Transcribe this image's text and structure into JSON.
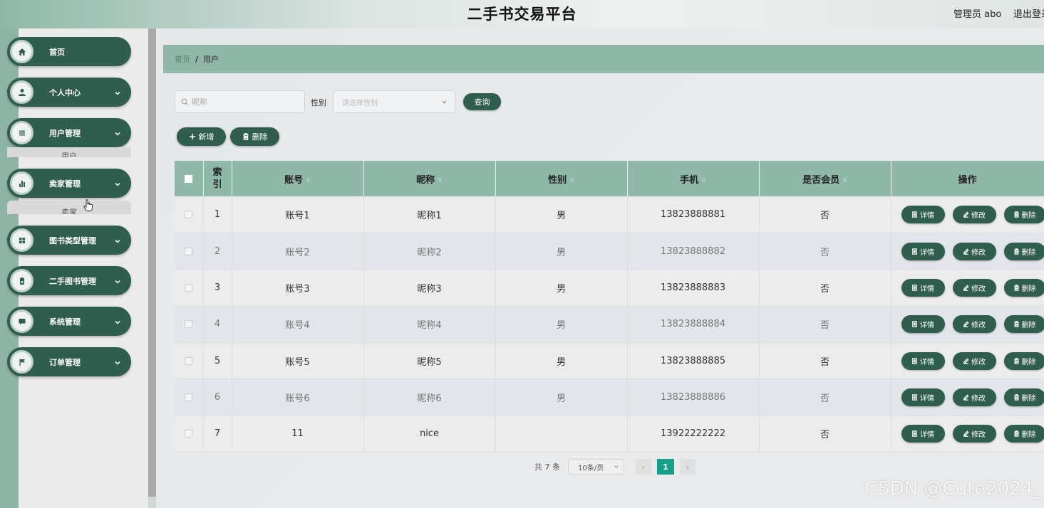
{
  "header": {
    "title": "二手书交易平台",
    "admin": "管理员 abo",
    "logout": "退出登录"
  },
  "sidebar": {
    "items": [
      {
        "label": "首页",
        "icon": "home-icon"
      },
      {
        "label": "个人中心",
        "icon": "user-icon"
      },
      {
        "label": "用户管理",
        "icon": "list-icon"
      },
      {
        "label": "卖家管理",
        "icon": "bar-chart-icon"
      },
      {
        "label": "图书类型管理",
        "icon": "grid-icon"
      },
      {
        "label": "二手图书管理",
        "icon": "clipboard-icon"
      },
      {
        "label": "系统管理",
        "icon": "chat-icon"
      },
      {
        "label": "订单管理",
        "icon": "flag-icon"
      }
    ],
    "sub_user": "用户",
    "sub_seller": "卖家"
  },
  "breadcrumb": {
    "home": "首页",
    "separator": "/",
    "current": "用户"
  },
  "search": {
    "nickname_placeholder": "昵称",
    "gender_label": "性别",
    "gender_placeholder": "请选择性别",
    "query_label": "查询"
  },
  "toolbar": {
    "add_label": "新增",
    "delete_label": "删除"
  },
  "table": {
    "headers": {
      "index": "索引",
      "account": "账号",
      "nickname": "昵称",
      "gender": "性别",
      "phone": "手机",
      "member": "是否会员",
      "actions": "操作"
    },
    "rows": [
      {
        "index": "1",
        "account": "账号1",
        "nickname": "昵称1",
        "gender": "男",
        "phone": "13823888881",
        "member": "否"
      },
      {
        "index": "2",
        "account": "账号2",
        "nickname": "昵称2",
        "gender": "男",
        "phone": "13823888882",
        "member": "否"
      },
      {
        "index": "3",
        "account": "账号3",
        "nickname": "昵称3",
        "gender": "男",
        "phone": "13823888883",
        "member": "否"
      },
      {
        "index": "4",
        "account": "账号4",
        "nickname": "昵称4",
        "gender": "男",
        "phone": "13823888884",
        "member": "否"
      },
      {
        "index": "5",
        "account": "账号5",
        "nickname": "昵称5",
        "gender": "男",
        "phone": "13823888885",
        "member": "否"
      },
      {
        "index": "6",
        "account": "账号6",
        "nickname": "昵称6",
        "gender": "男",
        "phone": "13823888886",
        "member": "否"
      },
      {
        "index": "7",
        "account": "11",
        "nickname": "nice",
        "gender": "",
        "phone": "13922222222",
        "member": "否"
      }
    ],
    "actions": {
      "detail": "详情",
      "edit": "修改",
      "delete": "删除"
    }
  },
  "pagination": {
    "total": "共 7 条",
    "page_size": "10条/页",
    "current_page": "1",
    "prev": "‹",
    "next": "›"
  },
  "watermark": "CSDN @Cute2024_",
  "colors": {
    "primary": "#2f5e4e",
    "accent": "#8fb8a8",
    "page_active": "#14a08a"
  }
}
